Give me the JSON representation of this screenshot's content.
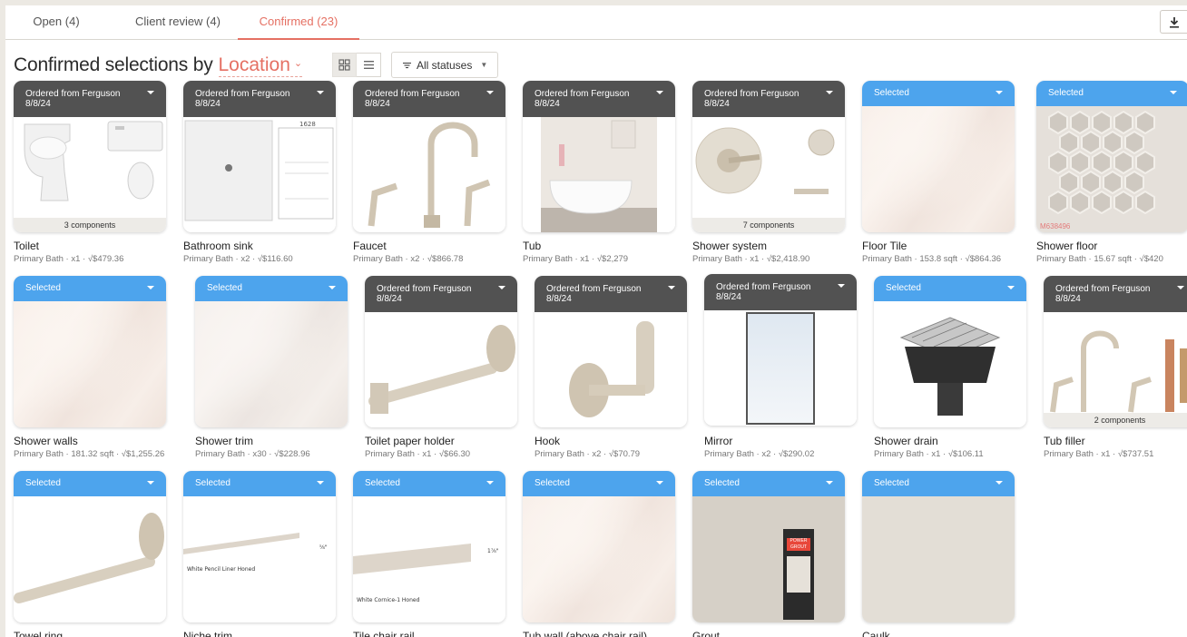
{
  "tabs": [
    {
      "label": "Open (4)"
    },
    {
      "label": "Client review (4)"
    },
    {
      "label": "Confirmed (23)"
    }
  ],
  "heading": {
    "title": "Confirmed selections by",
    "group_by": "Location"
  },
  "filter": {
    "label": "All statuses"
  },
  "colors": {
    "accent": "#e57063",
    "ordered": "#525252",
    "selected": "#4da4ed"
  },
  "cards": [
    {
      "status": "Ordered from Ferguson",
      "date": "8/8/24",
      "name": "Toilet",
      "meta": "Primary Bath · x1 · √$479.36",
      "components": "3 components"
    },
    {
      "status": "Ordered from Ferguson",
      "date": "8/8/24",
      "name": "Bathroom sink",
      "meta": "Primary Bath · x2 · √$116.60",
      "spec_code": "1628"
    },
    {
      "status": "Ordered from Ferguson",
      "date": "8/8/24",
      "name": "Faucet",
      "meta": "Primary Bath · x2 · √$866.78"
    },
    {
      "status": "Ordered from Ferguson",
      "date": "8/8/24",
      "name": "Tub",
      "meta": "Primary Bath · x1 · √$2,279"
    },
    {
      "status": "Ordered from Ferguson",
      "date": "8/8/24",
      "name": "Shower system",
      "meta": "Primary Bath · x1 · √$2,418.90",
      "components": "7 components"
    },
    {
      "status": "Selected",
      "name": "Floor Tile",
      "meta": "Primary Bath · 153.8 sqft · √$864.36"
    },
    {
      "status": "Selected",
      "name": "Shower floor",
      "meta": "Primary Bath · 15.67 sqft · √$420",
      "sku": "M638496"
    },
    {
      "status": "Selected",
      "name": "Shower walls",
      "meta": "Primary Bath · 181.32 sqft · √$1,255.26"
    },
    {
      "status": "Selected",
      "name": "Shower trim",
      "meta": "Primary Bath · x30 · √$228.96"
    },
    {
      "status": "Ordered from Ferguson",
      "date": "8/8/24",
      "name": "Toilet paper holder",
      "meta": "Primary Bath · x1 · √$66.30"
    },
    {
      "status": "Ordered from Ferguson",
      "date": "8/8/24",
      "name": "Hook",
      "meta": "Primary Bath · x2 · √$70.79"
    },
    {
      "status": "Ordered from Ferguson",
      "date": "8/8/24",
      "name": "Mirror",
      "meta": "Primary Bath · x2 · √$290.02"
    },
    {
      "status": "Selected",
      "name": "Shower drain",
      "meta": "Primary Bath · x1 · √$106.11"
    },
    {
      "status": "Ordered from Ferguson",
      "date": "8/8/24",
      "name": "Tub filler",
      "meta": "Primary Bath · x1 · √$737.51",
      "components": "2 components"
    },
    {
      "status": "Selected",
      "name": "Towel ring"
    },
    {
      "status": "Selected",
      "name": "Niche trim",
      "image_text": "White Pencil Liner Honed",
      "dim": "⅝\""
    },
    {
      "status": "Selected",
      "name": "Tile chair rail",
      "image_text": "White Cornice-1 Honed",
      "dim": "1⅞\""
    },
    {
      "status": "Selected",
      "name": "Tub wall (above chair rail)"
    },
    {
      "status": "Selected",
      "name": "Grout",
      "image_text": "POWER GROUT"
    },
    {
      "status": "Selected",
      "name": "Caulk"
    }
  ]
}
